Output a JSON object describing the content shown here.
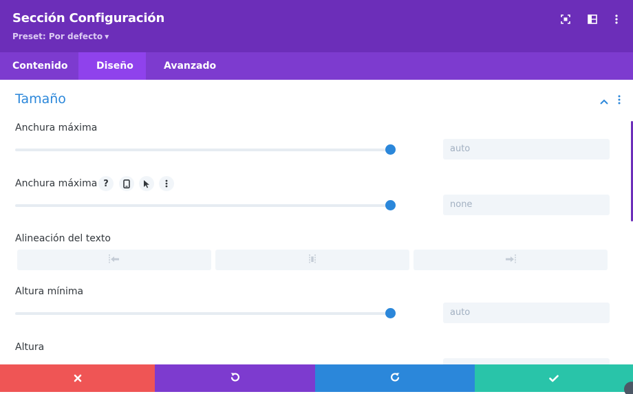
{
  "header": {
    "title": "Sección Configuración",
    "preset_label": "Preset: Por defecto",
    "icons": [
      "fullscreen-icon",
      "split-view-icon",
      "more-options-icon"
    ],
    "bg_color": "#6c2eb9"
  },
  "tabs": [
    {
      "label": "Contenido",
      "active": false
    },
    {
      "label": "Diseño",
      "active": true
    },
    {
      "label": "Avanzado",
      "active": false
    }
  ],
  "section": {
    "title": "Tamaño",
    "accent_color": "#2b87da"
  },
  "fields": {
    "max_width": {
      "label": "Anchura máxima",
      "value": "auto"
    },
    "max_width_2": {
      "label": "Anchura máxima",
      "value": "none",
      "help_glyph": "?",
      "icons": [
        "help-icon",
        "mobile-icon",
        "cursor-icon",
        "more-options-icon"
      ]
    },
    "text_align": {
      "label": "Alineación del texto",
      "options": [
        "align-left-icon",
        "align-center-icon",
        "align-right-icon"
      ]
    },
    "min_height": {
      "label": "Altura mínima",
      "value": "auto"
    },
    "height": {
      "label": "Altura"
    }
  },
  "footer": {
    "buttons": [
      {
        "action": "cancel",
        "icon": "close-icon",
        "color": "#ef5555"
      },
      {
        "action": "undo",
        "icon": "undo-icon",
        "color": "#7d3bcf"
      },
      {
        "action": "redo",
        "icon": "redo-icon",
        "color": "#2b87da"
      },
      {
        "action": "save",
        "icon": "check-icon",
        "color": "#29c4a9"
      }
    ]
  }
}
